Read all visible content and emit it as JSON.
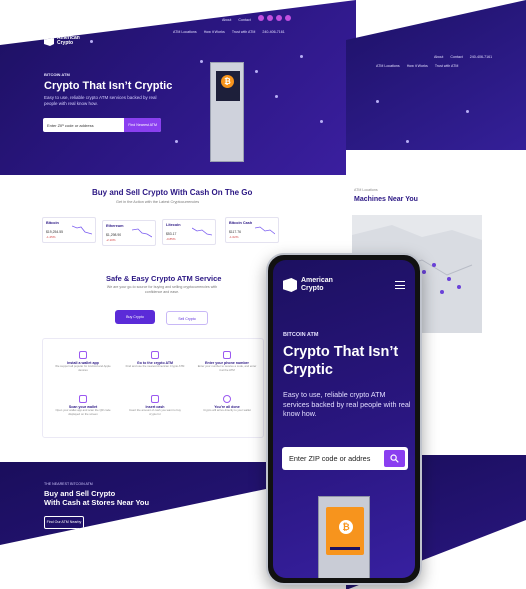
{
  "brand": {
    "name_line1": "American",
    "name_line2": "Crypto"
  },
  "desktop_nav": {
    "top_links": [
      "About",
      "Contact"
    ],
    "phone": "240-406-7161",
    "main_links": [
      "ATM Locations",
      "How it Works",
      "Trust with ATM"
    ]
  },
  "hero": {
    "eyebrow": "BITCOIN ATM",
    "title": "Crypto That Isn’t Cryptic",
    "subtitle": "Easy to use, reliable crypto ATM services backed by real people with real know how.",
    "search_placeholder": "Enter ZIP code or address",
    "search_button": "Find Nearest ATM"
  },
  "buy_sell": {
    "title": "Buy and Sell Crypto With Cash On The Go",
    "subtitle": "Get in the Action with the Latest Cryptocurrencies",
    "coins": [
      {
        "name": "Bitcoin",
        "price": "$19,254.55",
        "change": "-1.25%"
      },
      {
        "name": "Ethereum",
        "price": "$1,298.90",
        "change": "-2.10%"
      },
      {
        "name": "Litecoin",
        "price": "$53.17",
        "change": "-0.85%"
      },
      {
        "name": "Bitcoin Cash",
        "price": "$117.76",
        "change": "-1.02%"
      }
    ]
  },
  "service": {
    "title": "Safe & Easy Crypto ATM Service",
    "subtitle": "We are your go-to source for buying and selling cryptocurrencies with confidence and ease.",
    "buy_label": "Buy Crypto",
    "sell_label": "Sell Crypto",
    "steps": [
      {
        "title": "Install a wallet app",
        "desc": "We support all popular for Android and Apple devices"
      },
      {
        "title": "Go to the crypto ATM",
        "desc": "Find and use the nearest American Crypto ATM"
      },
      {
        "title": "Enter your phone number",
        "desc": "Enter your number to receive a code, and enter it at the ATM"
      },
      {
        "title": "Scan your wallet",
        "desc": "Open your wallet app and scan the QR code displayed on the screen"
      },
      {
        "title": "Insert cash",
        "desc": "Insert the amount of cash you want to buy crypto for"
      },
      {
        "title": "You’re all done",
        "desc": "Crypto will arrive directly to your wallet"
      }
    ]
  },
  "footer_cta": {
    "eyebrow": "THE NEAREST BITCOIN ATM",
    "title_line1": "Buy and Sell Crypto",
    "title_line2": "With Cash at Stores Near You",
    "button": "Find Our ATM Nearby"
  },
  "locations": {
    "breadcrumb": "ATM Locations",
    "title": "Machines Near You"
  },
  "phone_view": {
    "brand_line1": "American",
    "brand_line2": "Crypto",
    "eyebrow": "BITCOIN ATM",
    "title": "Crypto That Isn’t Cryptic",
    "subtitle": "Easy to use, reliable crypto ATM services backed by real people with real know how.",
    "search_placeholder": "Enter ZIP code or addres"
  },
  "colors": {
    "primary": "#2a1680",
    "accent": "#8a3ff0",
    "bitcoin": "#f7941d"
  },
  "icons": [
    "menu-icon",
    "search-icon",
    "bitcoin-icon",
    "social-icon"
  ]
}
